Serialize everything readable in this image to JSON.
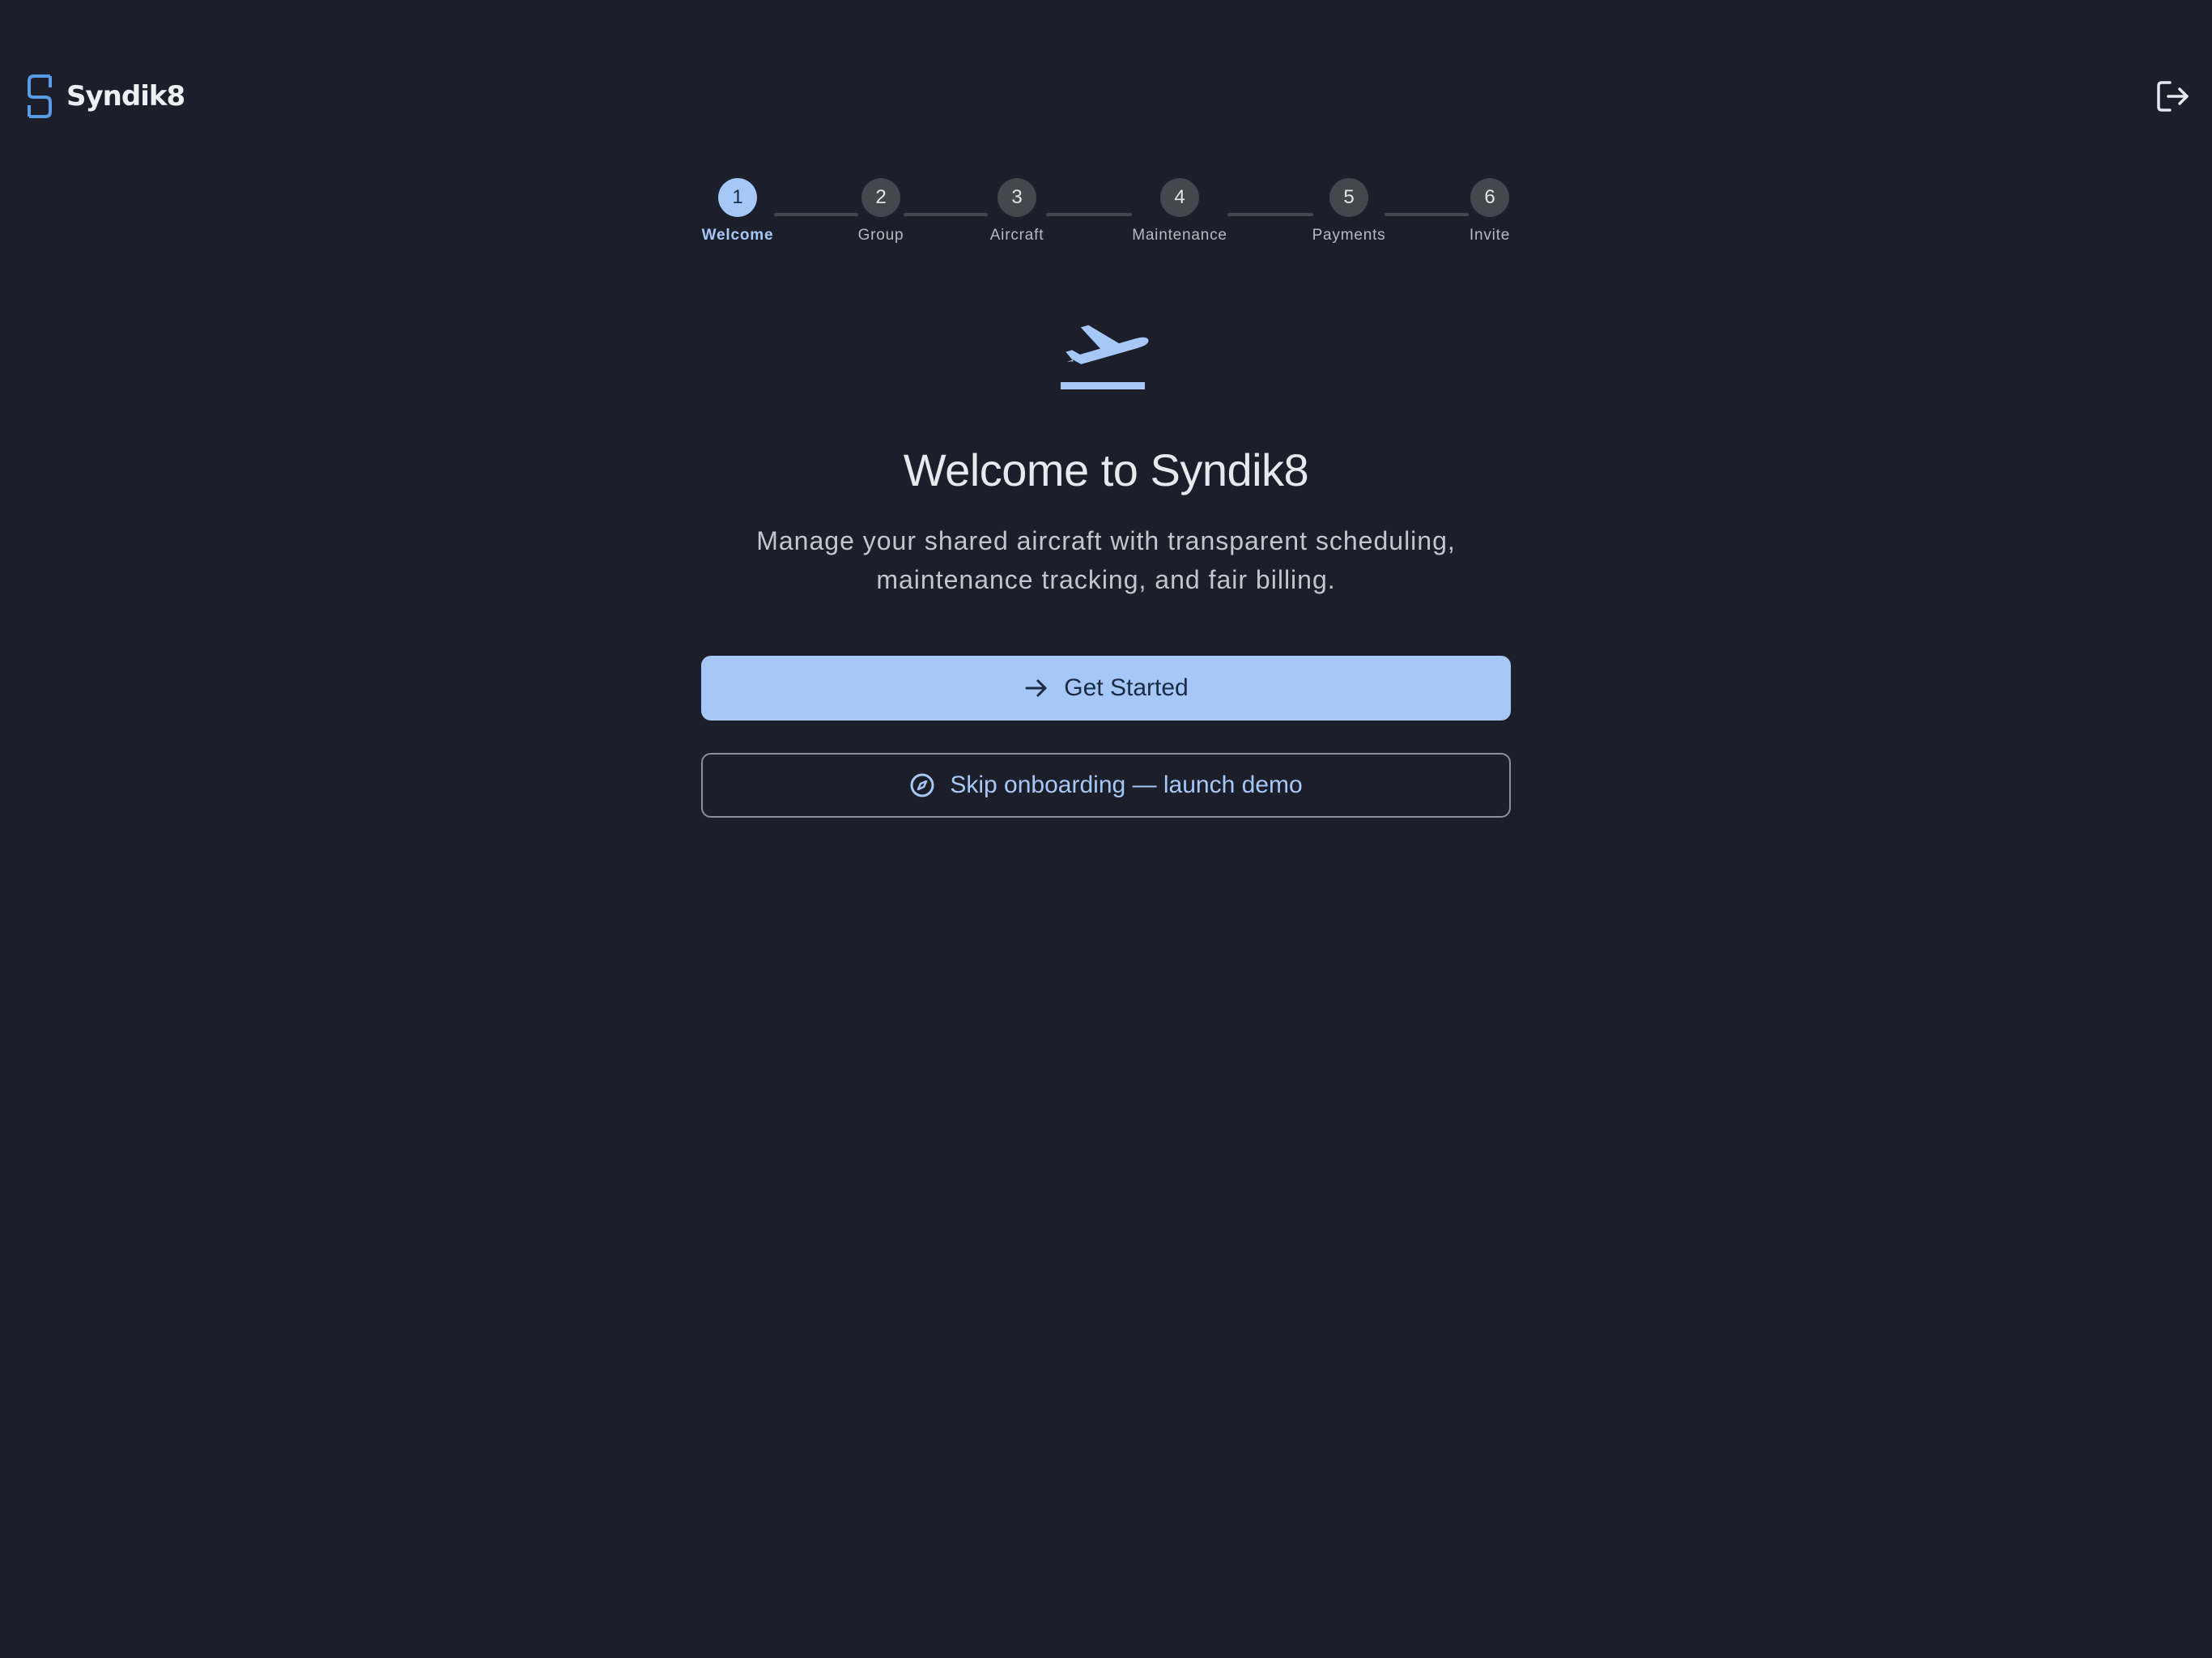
{
  "app": {
    "name": "Syndik8"
  },
  "header": {
    "logout_icon": "logout-icon"
  },
  "stepper": {
    "steps": [
      {
        "number": "1",
        "label": "Welcome",
        "active": true
      },
      {
        "number": "2",
        "label": "Group",
        "active": false
      },
      {
        "number": "3",
        "label": "Aircraft",
        "active": false
      },
      {
        "number": "4",
        "label": "Maintenance",
        "active": false
      },
      {
        "number": "5",
        "label": "Payments",
        "active": false
      },
      {
        "number": "6",
        "label": "Invite",
        "active": false
      }
    ]
  },
  "hero": {
    "icon": "airplane-takeoff-icon",
    "title": "Welcome to Syndik8",
    "subtitle_line1": "Manage your shared aircraft with transparent scheduling,",
    "subtitle_line2": "maintenance tracking, and fair billing."
  },
  "actions": {
    "primary_label": "Get Started",
    "primary_icon": "arrow-right-icon",
    "secondary_label": "Skip onboarding — launch demo",
    "secondary_icon": "compass-icon"
  },
  "colors": {
    "background": "#1c1f2a",
    "accent": "#a6c8f8",
    "step_inactive": "#45474e",
    "text_primary": "#e8e9ee",
    "text_secondary": "#c4c6ce"
  }
}
